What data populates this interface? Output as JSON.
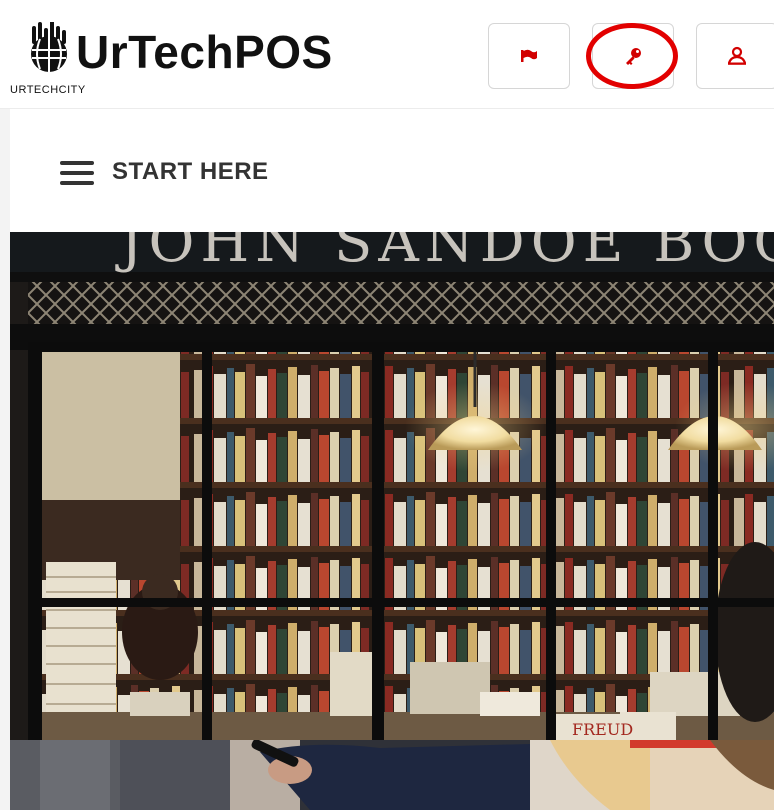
{
  "header": {
    "brand_name": "UrTechPOS",
    "brand_sub": "URTECHCITY",
    "buttons": [
      {
        "icon": "flag-icon"
      },
      {
        "icon": "key-icon"
      },
      {
        "icon": "user-icon"
      }
    ],
    "accent_color": "#e20000"
  },
  "nav": {
    "menu_label": "START HERE"
  },
  "hero": {
    "sign_text": "JOHN SANDOE BOOK",
    "book_spine_text": "FREUD"
  }
}
